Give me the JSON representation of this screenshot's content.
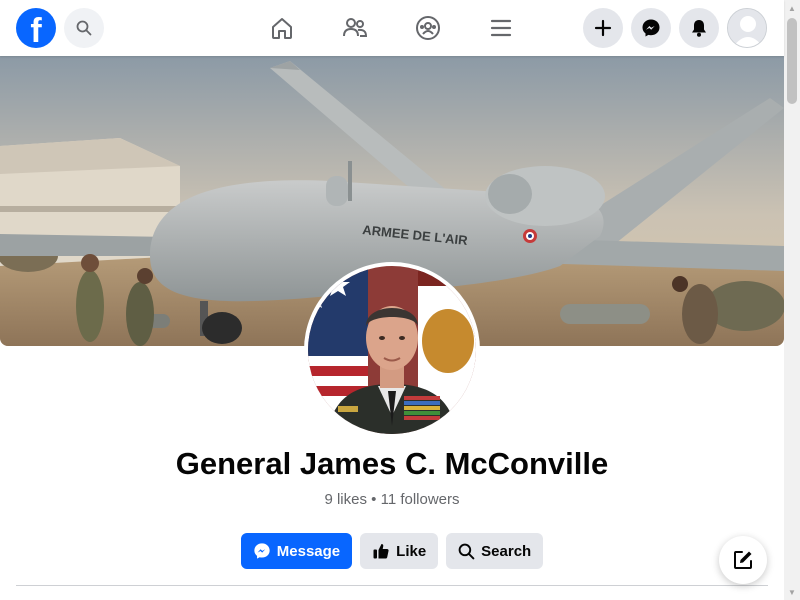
{
  "topbar": {
    "logo_letter": "f",
    "nav": [
      "home-icon",
      "friends-icon",
      "groups-icon",
      "menu-icon"
    ],
    "right": [
      "plus-icon",
      "messenger-icon",
      "bell-icon",
      "avatar"
    ]
  },
  "page": {
    "name": "General James C. McConville",
    "likes": "9 likes",
    "separator": "•",
    "followers": "11 followers"
  },
  "actions": {
    "message_label": "Message",
    "like_label": "Like",
    "search_label": "Search"
  },
  "cover": {
    "aircraft_marking": "ARMEE DE L'AIR"
  },
  "colors": {
    "brand_blue": "#0866ff",
    "secondary_bg": "#e4e6eb",
    "muted_text": "#65676b"
  }
}
